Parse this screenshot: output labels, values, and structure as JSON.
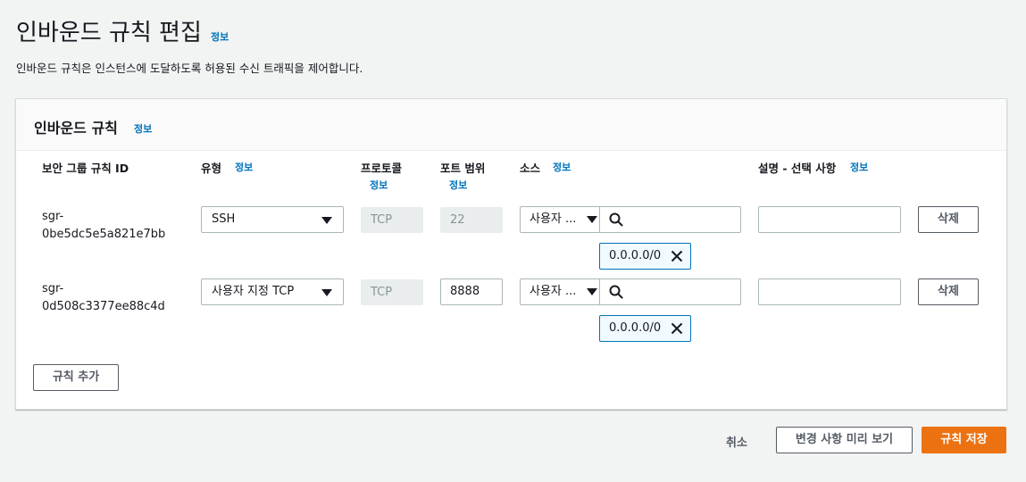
{
  "page": {
    "title": "인바운드 규칙 편집",
    "info": "정보",
    "description": "인바운드 규칙은 인스턴스에 도달하도록 허용된 수신 트래픽을 제어합니다."
  },
  "panel": {
    "title": "인바운드 규칙",
    "info": "정보",
    "columns": {
      "rule_id": "보안 그룹 규칙 ID",
      "type": "유형",
      "type_info": "정보",
      "protocol": "프로토콜",
      "protocol_info": "정보",
      "port_range": "포트 범위",
      "port_range_info": "정보",
      "source": "소스",
      "source_info": "정보",
      "description": "설명 - 선택 사항",
      "description_info": "정보"
    },
    "rows": [
      {
        "rule_id_line1": "sgr-",
        "rule_id_line2": "0be5dc5e5a821e7bb",
        "type": "SSH",
        "protocol": "TCP",
        "port": "22",
        "source_type": "사용자 ...",
        "source_cidr": "0.0.0.0/0",
        "description": "",
        "delete_label": "삭제"
      },
      {
        "rule_id_line1": "sgr-",
        "rule_id_line2": "0d508c3377ee88c4d",
        "type": "사용자 지정 TCP",
        "protocol": "TCP",
        "port": "8888",
        "source_type": "사용자 ...",
        "source_cidr": "0.0.0.0/0",
        "description": "",
        "delete_label": "삭제"
      }
    ],
    "add_rule_label": "규칙 추가"
  },
  "footer": {
    "cancel_label": "취소",
    "preview_label": "변경 사항 미리 보기",
    "save_label": "규칙 저장"
  },
  "colors": {
    "accent": "#ec7211",
    "link": "#0073bb",
    "token_border": "#0073bb"
  }
}
